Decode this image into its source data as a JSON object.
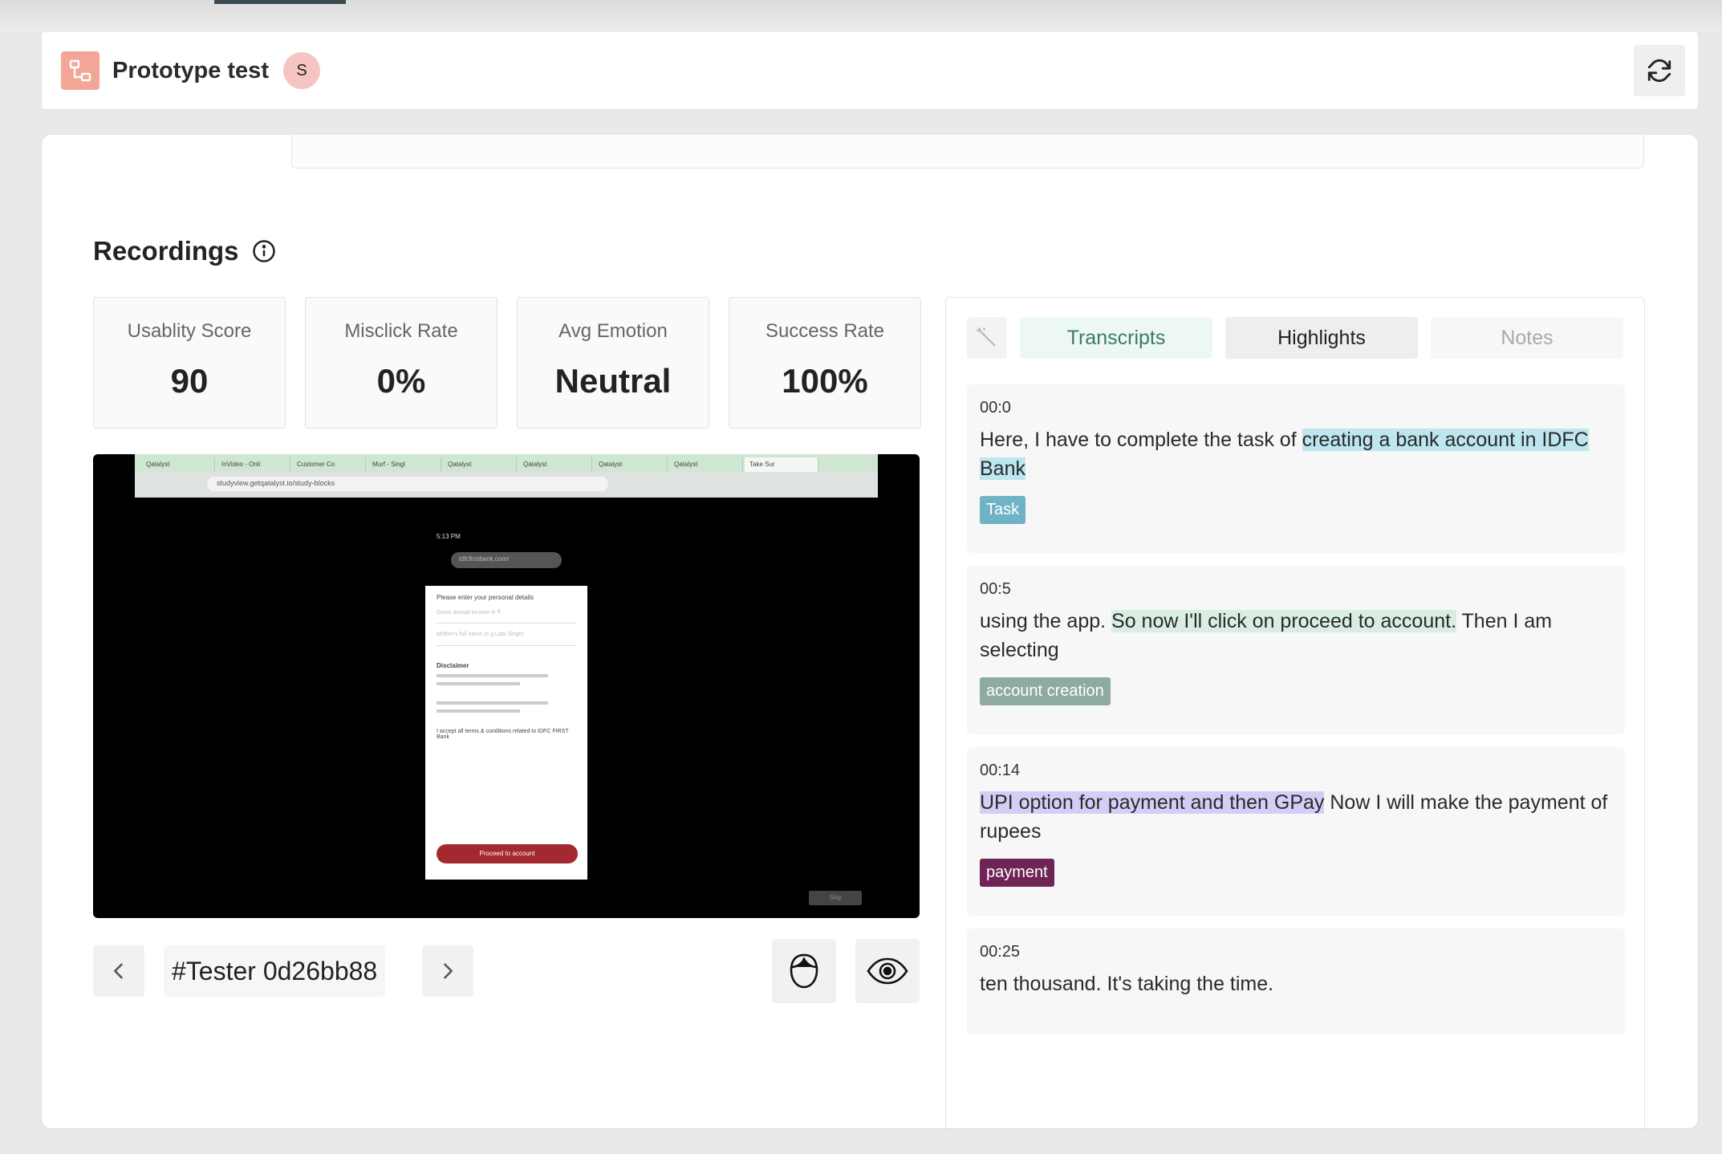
{
  "header": {
    "project_title": "Prototype test",
    "avatar_initial": "S",
    "accent_color": "#f2a696"
  },
  "section": {
    "title": "Recordings"
  },
  "metrics": [
    {
      "label": "Usablity Score",
      "value": "90"
    },
    {
      "label": "Misclick Rate",
      "value": "0%"
    },
    {
      "label": "Avg Emotion",
      "value": "Neutral"
    },
    {
      "label": "Success Rate",
      "value": "100%"
    }
  ],
  "video": {
    "browser_tabs": [
      "Qatalyst",
      "InVideo - Onli",
      "Customer Co",
      "Murf - Singl",
      "Qatalyst",
      "Qatalyst",
      "Qatalyst",
      "Qatalyst",
      "Take Sur"
    ],
    "browser_url": "studyview.getqatalyst.io/study-blocks",
    "phone_time": "5:13 PM",
    "phone_url": "idfcfirstbank.com/",
    "form_heading": "Please enter your personal details",
    "field_1_placeholder": "Gross annual income in ₹",
    "field_2_placeholder": "Mother's full name (e.g Lata Singh)",
    "disclaimer_heading": "Disclaimer",
    "terms_text": "I accept all terms & conditions related to IDFC FIRST Bank",
    "proceed_label": "Proceed to account",
    "skip_label": "Skip"
  },
  "player": {
    "tester_id": "#Tester 0d26bb88"
  },
  "panel": {
    "tabs": [
      "Transcripts",
      "Highlights",
      "Notes"
    ],
    "active_tab": "Highlights",
    "entries": [
      {
        "timestamp": "00:0",
        "pre": "Here, I have to complete the task of ",
        "highlight": "creating a bank account in IDFC Bank",
        "post": "",
        "tag": "Task",
        "tag_color": "#6fb3c6",
        "highlight_color": "#bde6ee"
      },
      {
        "timestamp": "00:5",
        "pre": "using the app. ",
        "highlight": "So now I'll click on proceed to account.",
        "post": " Then I am selecting",
        "tag": "account creation",
        "tag_color": "#8fa9a3",
        "highlight_color": "#d9ede2"
      },
      {
        "timestamp": "00:14",
        "pre": "",
        "highlight": "UPI option for payment and then GPay",
        "post": " Now I will make the payment of rupees",
        "tag": "payment",
        "tag_color": "#6f2456",
        "highlight_color": "#d6cdf7"
      },
      {
        "timestamp": "00:25",
        "pre": "ten thousand. It's taking the time.",
        "highlight": "",
        "post": "",
        "tag": "",
        "tag_color": "",
        "highlight_color": ""
      }
    ]
  }
}
